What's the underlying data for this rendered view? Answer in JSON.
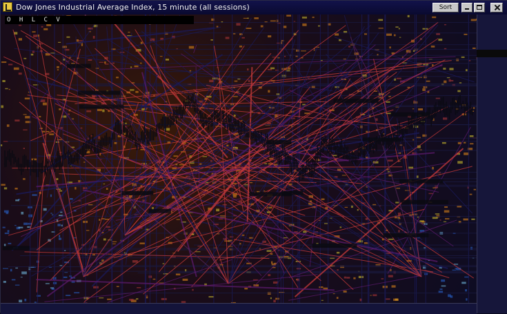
{
  "window": {
    "title": "Dow Jones Industrial Average Index, 15 minute (all sessions)",
    "sort_label": "Sort"
  },
  "ohlc": [
    "O",
    "H",
    "L",
    "C",
    "V"
  ],
  "price_scale": {
    "labels": [
      "",
      "",
      "",
      "",
      "",
      "",
      "",
      ""
    ],
    "last_price": ""
  },
  "time_axis": {
    "labels": [
      "",
      "",
      "",
      "",
      "",
      ""
    ]
  },
  "colors": {
    "price_bars": "#0a0a12",
    "trendline_red": "#c83a3a",
    "trendline_navy": "#1a1a5a",
    "accent_yellow": "#e8c842",
    "noise_blue": "#2a6ad8",
    "noise_orange": "#e88a1a"
  },
  "icons": {
    "app": "chart-app-icon",
    "minimize": "minimize-icon",
    "maximize": "maximize-icon",
    "close": "close-icon"
  }
}
